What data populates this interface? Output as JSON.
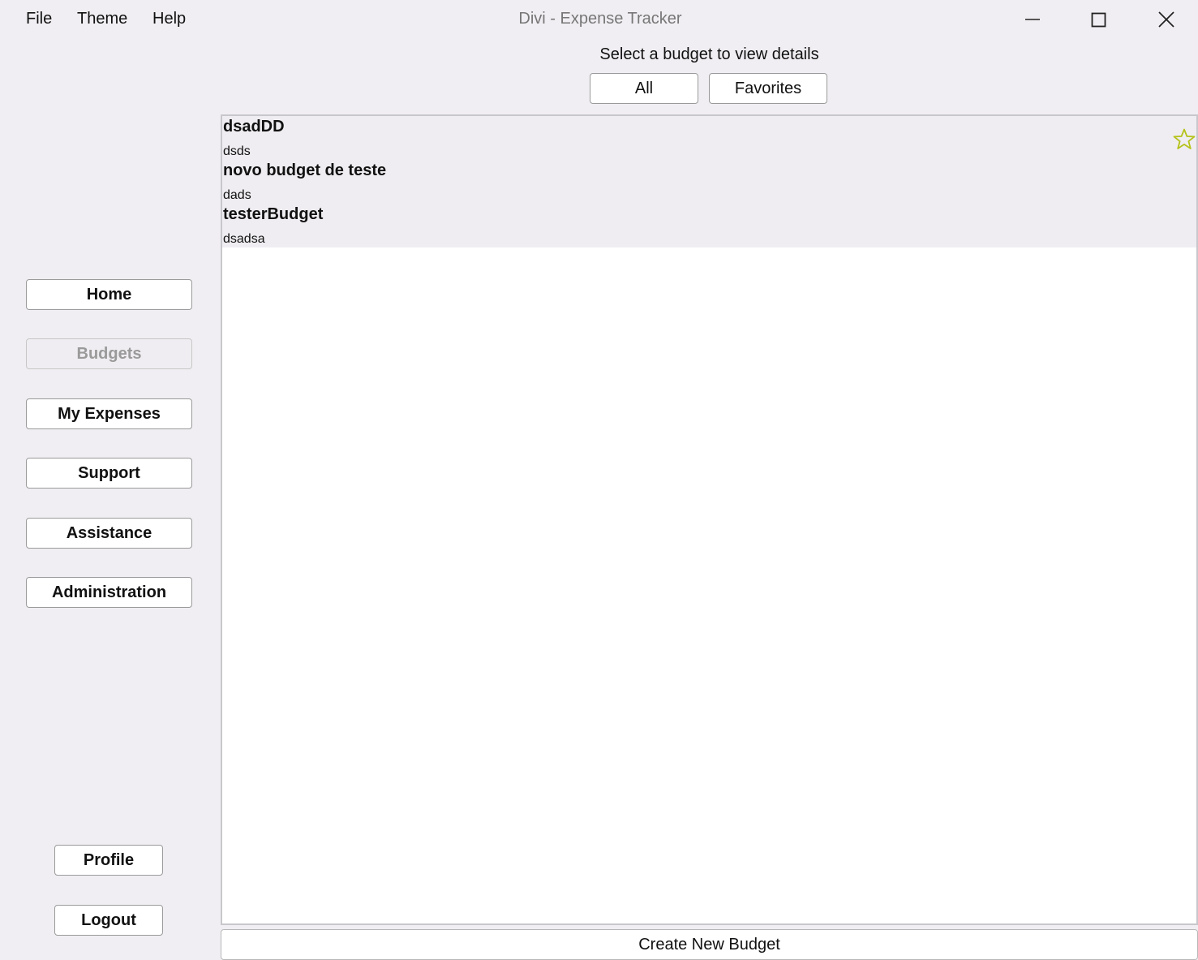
{
  "menu": {
    "file": "File",
    "theme": "Theme",
    "help": "Help"
  },
  "window": {
    "title": "Divi - Expense Tracker"
  },
  "header": {
    "prompt": "Select a budget to view details",
    "filters": {
      "all": "All",
      "favorites": "Favorites"
    }
  },
  "sidebar": {
    "items": [
      {
        "label": "Home",
        "disabled": false
      },
      {
        "label": "Budgets",
        "disabled": true
      },
      {
        "label": "My Expenses",
        "disabled": false
      },
      {
        "label": "Support",
        "disabled": false
      },
      {
        "label": "Assistance",
        "disabled": false
      },
      {
        "label": "Administration",
        "disabled": false
      }
    ],
    "profile": "Profile",
    "logout": "Logout"
  },
  "budgets": [
    {
      "title": "dsadDD",
      "description": "dsds",
      "icon": "star-outline-icon"
    },
    {
      "title": "novo budget de teste",
      "description": "dads"
    },
    {
      "title": "testerBudget",
      "description": "dsadsa"
    }
  ],
  "actions": {
    "create_budget": "Create New Budget"
  },
  "colors": {
    "star": "#b5c21a",
    "disabled_text": "#9a9a9a"
  }
}
